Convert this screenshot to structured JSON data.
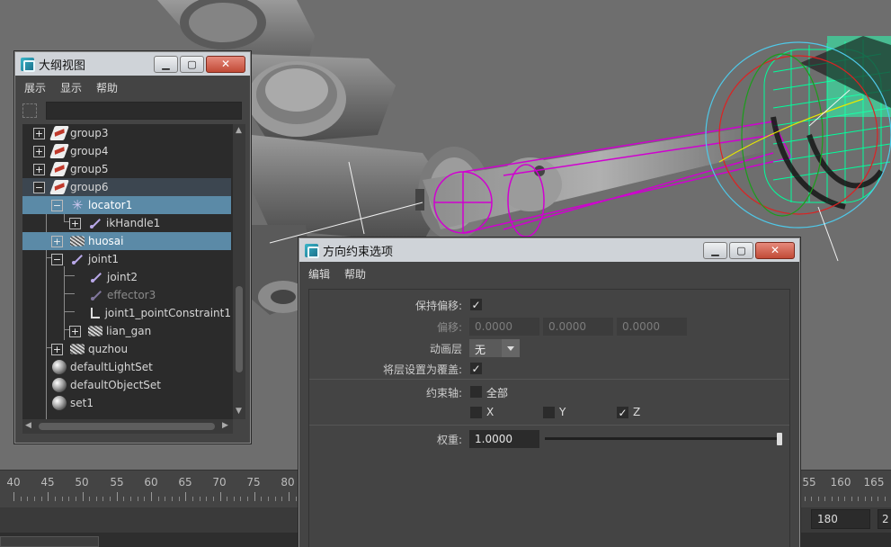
{
  "outliner": {
    "title": "大纲视图",
    "menu": [
      "展示",
      "显示",
      "帮助"
    ],
    "filter_value": "",
    "items": [
      {
        "label": "group3",
        "icon": "group-icon"
      },
      {
        "label": "group4",
        "icon": "group-icon"
      },
      {
        "label": "group5",
        "icon": "group-icon"
      },
      {
        "label": "group6",
        "icon": "group-icon"
      },
      {
        "label": "locator1",
        "icon": "locator-icon"
      },
      {
        "label": "ikHandle1",
        "icon": "ik-handle-icon"
      },
      {
        "label": "huosai",
        "icon": "mesh-icon"
      },
      {
        "label": "joint1",
        "icon": "joint-icon"
      },
      {
        "label": "joint2",
        "icon": "joint-icon"
      },
      {
        "label": "effector3",
        "icon": "effector-icon"
      },
      {
        "label": "joint1_pointConstraint1",
        "icon": "constraint-icon"
      },
      {
        "label": "lian_gan",
        "icon": "mesh-icon"
      },
      {
        "label": "quzhou",
        "icon": "mesh-icon"
      },
      {
        "label": "defaultLightSet",
        "icon": "set-icon"
      },
      {
        "label": "defaultObjectSet",
        "icon": "set-icon"
      },
      {
        "label": "set1",
        "icon": "set-icon"
      }
    ]
  },
  "orient": {
    "title": "方向约束选项",
    "menu": [
      "编辑",
      "帮助"
    ],
    "maintain_offset_label": "保持偏移:",
    "maintain_offset_checked": true,
    "offset_label": "偏移:",
    "offset_values": [
      "0.0000",
      "0.0000",
      "0.0000"
    ],
    "anim_layer_label": "动画层",
    "anim_layer_value": "无",
    "set_override_label": "将层设置为覆盖:",
    "set_override_checked": true,
    "constraint_axes_label": "约束轴:",
    "all_label": "全部",
    "all_checked": false,
    "axes": [
      {
        "label": "X",
        "checked": false
      },
      {
        "label": "Y",
        "checked": false
      },
      {
        "label": "Z",
        "checked": true
      }
    ],
    "weight_label": "权重:",
    "weight_value": "1.0000",
    "weight_fraction": 1.0
  },
  "timeline": {
    "ticks_left": [
      "40",
      "45",
      "50",
      "55",
      "60",
      "65",
      "70",
      "75",
      "80"
    ],
    "ticks_right": [
      "55",
      "160",
      "165"
    ],
    "range_end": "180",
    "range_end_next": "2"
  },
  "colors": {
    "selection": "#5b8aa7",
    "viewport_bg": "#6e6e6e",
    "rig_magenta": "#d000d0",
    "wire_green": "#00ff9c"
  }
}
